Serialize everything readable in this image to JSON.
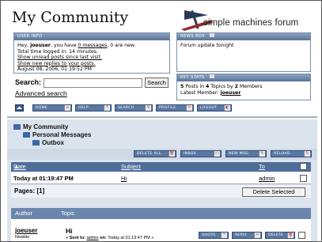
{
  "header": {
    "title": "My Community",
    "logo_text": "simple machines forum"
  },
  "user_info": {
    "heading": "USER INFO",
    "greeting_prefix": "Hey, ",
    "username": "joeuser",
    "greeting_mid": ", you have ",
    "messages_link": "0 messages",
    "greeting_suffix": ", 0 are new.",
    "time_logged": "Total time logged in: 14 minutes.",
    "unread_link": "Show unread posts since last visit.",
    "replies_link": "Show new replies to your posts.",
    "datetime": "August 08, 2006, 01:19:52 PM"
  },
  "news_box": {
    "heading": "NEWS BOX",
    "text": "Forum update tonight"
  },
  "key_stats": {
    "heading": "KEY STATS",
    "posts": "5",
    "posts_label": " Posts in ",
    "topics": "4",
    "topics_label": " Topics by ",
    "members": "2",
    "members_label": " Members",
    "latest_label": "Latest Member: ",
    "latest_member": "joeuser"
  },
  "search": {
    "label": "Search:",
    "value": "",
    "button": "Search",
    "advanced": "Advanced search"
  },
  "menu": {
    "home": "HOME",
    "help": "HELP",
    "search": "SEARCH",
    "profile": "PROFILE",
    "logout": "LOGOUT"
  },
  "breadcrumb": {
    "level1": "My Community",
    "level2": "Personal Messages",
    "level3": "Outbox"
  },
  "actions": {
    "delete_all": "DELETE ALL",
    "inbox": "INBOX",
    "new_msg": "NEW MSG",
    "reload": "RELOAD"
  },
  "table": {
    "col_date": "Date",
    "col_subject": "Subject",
    "col_to": "To",
    "rows": [
      {
        "date": "Today at 01:19:47 PM",
        "subject": "Hi",
        "to": "admin"
      }
    ]
  },
  "pages": {
    "label": "Pages: [1]",
    "delete_selected": "Delete Selected"
  },
  "message": {
    "col_author": "Author",
    "col_topic": "Topic",
    "author": "joeuser",
    "rank": "Newbie",
    "subject": "Hi",
    "sent_to_label": "« Sent to: ",
    "sent_to": "admin",
    "on_label": " on: ",
    "sent_date": "Today at 01:19:47 PM »",
    "quote": "QUOTE",
    "reply": "REPLY",
    "delete": "DELETE"
  },
  "colors": {
    "header_blue": "#5a7398",
    "menu_blue": "#5b78a3",
    "panel_bg": "#dbe3ec"
  }
}
